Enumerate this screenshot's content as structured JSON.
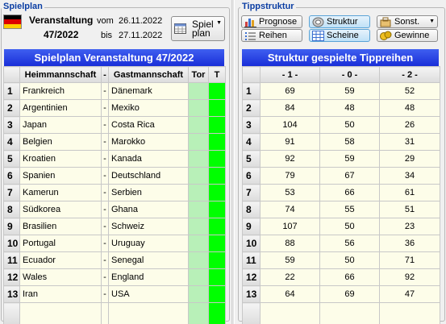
{
  "left": {
    "title": "Spielplan",
    "flag_colors": [
      "#000000",
      "#dd0000",
      "#ffce00"
    ],
    "event_label": "Veranstaltung",
    "event_number": "47/2022",
    "from_label": "vom",
    "from_date": "26.11.2022",
    "to_label": "bis",
    "to_date": "27.11.2022",
    "spielplan_button": [
      "Spiel",
      "plan"
    ],
    "table_title": "Spielplan Veranstaltung 47/2022",
    "columns": [
      "Heimmannschaft",
      "-",
      "Gastmannschaft",
      "Tor",
      "T"
    ],
    "rows": [
      {
        "n": "1",
        "home": "Frankreich",
        "sep": "-",
        "away": "Dänemark"
      },
      {
        "n": "2",
        "home": "Argentinien",
        "sep": "-",
        "away": "Mexiko"
      },
      {
        "n": "3",
        "home": "Japan",
        "sep": "-",
        "away": "Costa Rica"
      },
      {
        "n": "4",
        "home": "Belgien",
        "sep": "-",
        "away": "Marokko"
      },
      {
        "n": "5",
        "home": "Kroatien",
        "sep": "-",
        "away": "Kanada"
      },
      {
        "n": "6",
        "home": "Spanien",
        "sep": "-",
        "away": "Deutschland"
      },
      {
        "n": "7",
        "home": "Kamerun",
        "sep": "-",
        "away": "Serbien"
      },
      {
        "n": "8",
        "home": "Südkorea",
        "sep": "-",
        "away": "Ghana"
      },
      {
        "n": "9",
        "home": "Brasilien",
        "sep": "-",
        "away": "Schweiz"
      },
      {
        "n": "10",
        "home": "Portugal",
        "sep": "-",
        "away": "Uruguay"
      },
      {
        "n": "11",
        "home": "Ecuador",
        "sep": "-",
        "away": "Senegal"
      },
      {
        "n": "12",
        "home": "Wales",
        "sep": "-",
        "away": "England"
      },
      {
        "n": "13",
        "home": "Iran",
        "sep": "-",
        "away": "USA"
      }
    ]
  },
  "right": {
    "title": "Tippstruktur",
    "buttons": {
      "prognose": "Prognose",
      "struktur": "Struktur",
      "sonst": "Sonst.",
      "reihen": "Reihen",
      "scheine": "Scheine",
      "gewinne": "Gewinne"
    },
    "table_title": "Struktur gespielte Tippreihen",
    "columns": [
      "- 1 -",
      "- 0 -",
      "- 2 -"
    ],
    "rows": [
      {
        "n": "1",
        "v1": "69",
        "v0": "59",
        "v2": "52"
      },
      {
        "n": "2",
        "v1": "84",
        "v0": "48",
        "v2": "48"
      },
      {
        "n": "3",
        "v1": "104",
        "v0": "50",
        "v2": "26"
      },
      {
        "n": "4",
        "v1": "91",
        "v0": "58",
        "v2": "31"
      },
      {
        "n": "5",
        "v1": "92",
        "v0": "59",
        "v2": "29"
      },
      {
        "n": "6",
        "v1": "79",
        "v0": "67",
        "v2": "34"
      },
      {
        "n": "7",
        "v1": "53",
        "v0": "66",
        "v2": "61"
      },
      {
        "n": "8",
        "v1": "74",
        "v0": "55",
        "v2": "51"
      },
      {
        "n": "9",
        "v1": "107",
        "v0": "50",
        "v2": "23"
      },
      {
        "n": "10",
        "v1": "88",
        "v0": "56",
        "v2": "36"
      },
      {
        "n": "11",
        "v1": "59",
        "v0": "50",
        "v2": "71"
      },
      {
        "n": "12",
        "v1": "22",
        "v0": "66",
        "v2": "92"
      },
      {
        "n": "13",
        "v1": "64",
        "v0": "69",
        "v2": "47"
      }
    ]
  }
}
